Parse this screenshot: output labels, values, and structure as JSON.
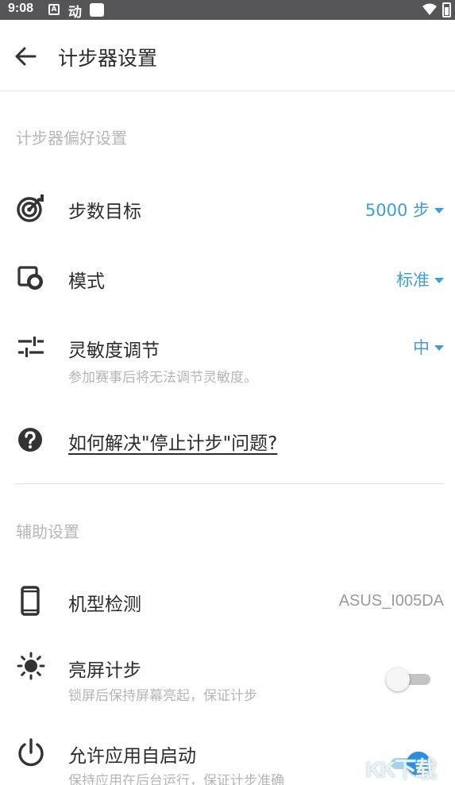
{
  "status_bar": {
    "time": "9:08",
    "badge_text": "A",
    "move_text": "动",
    "icons": [
      "a-box-icon",
      "move-icon",
      "square-icon",
      "wifi-icon",
      "battery-icon"
    ]
  },
  "header": {
    "title": "计步器设置",
    "back_icon": "arrow-left-icon"
  },
  "sections": {
    "pedometer": {
      "title": "计步器偏好设置",
      "items": [
        {
          "label": "步数目标",
          "value": "5000 步",
          "icon": "target-icon"
        },
        {
          "label": "模式",
          "value": "标准",
          "icon": "mode-icon"
        },
        {
          "label": "灵敏度调节",
          "value": "中",
          "subtitle": "参加赛事后将无法调节灵敏度。",
          "icon": "sliders-icon"
        },
        {
          "label": "如何解决\"停止计步\"问题?",
          "icon": "help-icon"
        }
      ]
    },
    "assist": {
      "title": "辅助设置",
      "items": [
        {
          "label": "机型检测",
          "value": "ASUS_I005DA",
          "icon": "phone-icon"
        },
        {
          "label": "亮屏计步",
          "subtitle": "锁屏后保持屏幕亮起，保证计步",
          "toggle": false,
          "icon": "brightness-icon"
        },
        {
          "label": "允许应用自启动",
          "subtitle": "保持应用在后台运行，保证计步准确",
          "toggle": true,
          "icon": "power-icon"
        }
      ]
    }
  },
  "watermark": "KK下载",
  "colors": {
    "accent": "#3f9fd4",
    "status_bar": "#555558",
    "section_title": "#b7b7b7",
    "toggle_on": "#2a8ee0"
  }
}
